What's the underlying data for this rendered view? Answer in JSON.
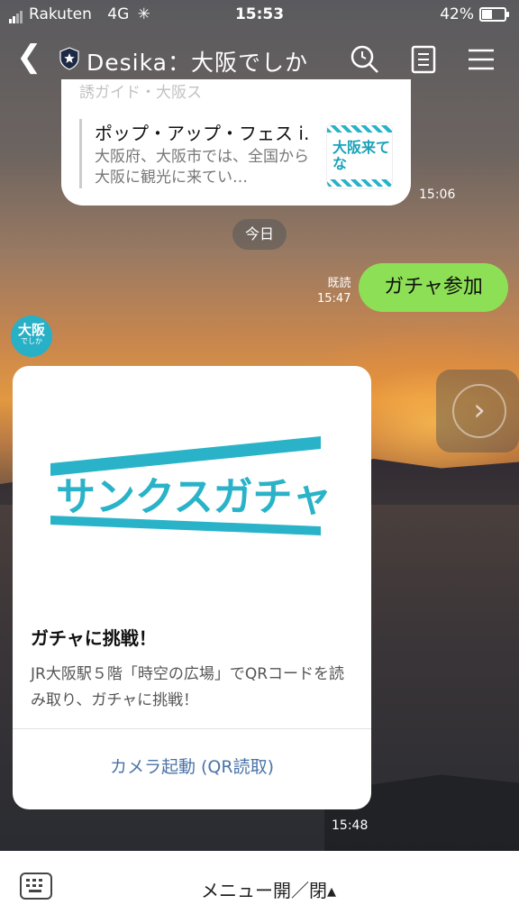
{
  "status": {
    "carrier": "Rakuten",
    "network": "4G",
    "time": "15:53",
    "battery": "42%"
  },
  "header": {
    "title": "Desika：大阪でしか"
  },
  "chat": {
    "faded_line": "誘ガイド・大阪ス",
    "article": {
      "title": "ポップ・アップ・フェス i…",
      "desc": "大阪府、大阪市では、全国から大阪に観光に来てい…",
      "thumb_text": "大阪来てな"
    },
    "ts1": "15:06",
    "day_label": "今日",
    "my_message": {
      "read": "既読",
      "time": "15:47",
      "text": "ガチャ参加"
    },
    "avatar": {
      "line1": "大阪",
      "line2": "でしか"
    },
    "card": {
      "banner_text": "サンクスガチャ",
      "heading": "ガチャに挑戦！",
      "body": "JR大阪駅５階「時空の広場」でQRコードを読み取り、ガチャに挑戦！",
      "action": "カメラ起動 (QR読取)",
      "time": "15:48"
    }
  },
  "bottom": {
    "menu_label": "メニュー開／閉▴"
  },
  "colors": {
    "accent": "#28b0c6",
    "bubble": "#8de055",
    "link": "#4a74a8"
  }
}
